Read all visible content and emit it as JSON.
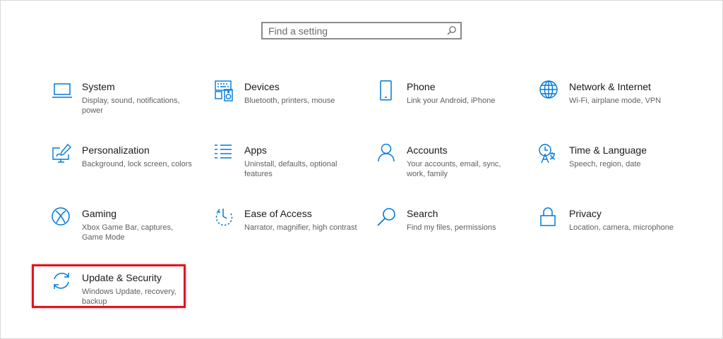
{
  "search": {
    "placeholder": "Find a setting",
    "icon": "search-icon"
  },
  "accent_color": "#0078d7",
  "highlight_color": "#e0161f",
  "tiles": [
    {
      "id": "system",
      "title": "System",
      "desc": "Display, sound, notifications, power",
      "icon": "laptop-icon"
    },
    {
      "id": "devices",
      "title": "Devices",
      "desc": "Bluetooth, printers, mouse",
      "icon": "keyboard-speaker-icon"
    },
    {
      "id": "phone",
      "title": "Phone",
      "desc": "Link your Android, iPhone",
      "icon": "phone-icon"
    },
    {
      "id": "network",
      "title": "Network & Internet",
      "desc": "Wi-Fi, airplane mode, VPN",
      "icon": "globe-icon"
    },
    {
      "id": "personalization",
      "title": "Personalization",
      "desc": "Background, lock screen, colors",
      "icon": "paintbrush-monitor-icon"
    },
    {
      "id": "apps",
      "title": "Apps",
      "desc": "Uninstall, defaults, optional features",
      "icon": "list-icon"
    },
    {
      "id": "accounts",
      "title": "Accounts",
      "desc": "Your accounts, email, sync, work, family",
      "icon": "person-icon"
    },
    {
      "id": "time-language",
      "title": "Time & Language",
      "desc": "Speech, region, date",
      "icon": "time-language-icon"
    },
    {
      "id": "gaming",
      "title": "Gaming",
      "desc": "Xbox Game Bar, captures, Game Mode",
      "icon": "xbox-icon"
    },
    {
      "id": "ease-of-access",
      "title": "Ease of Access",
      "desc": "Narrator, magnifier, high contrast",
      "icon": "ease-of-access-icon"
    },
    {
      "id": "search",
      "title": "Search",
      "desc": "Find my files, permissions",
      "icon": "magnifier-icon"
    },
    {
      "id": "privacy",
      "title": "Privacy",
      "desc": "Location, camera, microphone",
      "icon": "lock-icon"
    },
    {
      "id": "update-security",
      "title": "Update & Security",
      "desc": "Windows Update, recovery, backup",
      "icon": "sync-arrows-icon"
    }
  ]
}
